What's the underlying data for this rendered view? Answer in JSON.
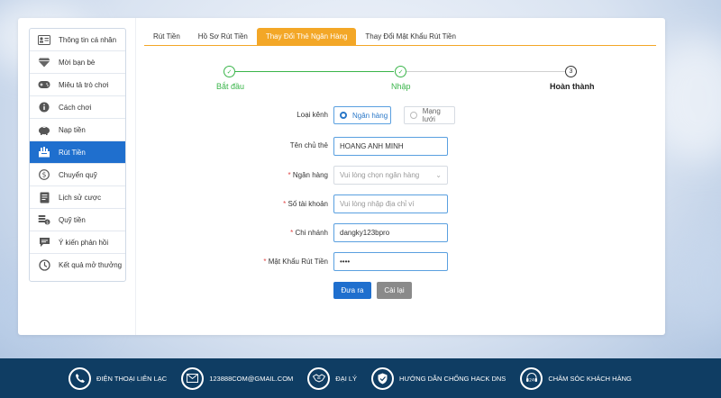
{
  "sidebar": {
    "items": [
      {
        "label": "Thông tin cá nhân",
        "icon": "id-card-icon"
      },
      {
        "label": "Mời bạn bè",
        "icon": "diamond-icon"
      },
      {
        "label": "Miêu tả trò chơi",
        "icon": "gamepad-icon"
      },
      {
        "label": "Cách chơi",
        "icon": "info-icon"
      },
      {
        "label": "Nạp tiền",
        "icon": "piggy-bank-icon"
      },
      {
        "label": "Rút Tiền",
        "icon": "withdraw-icon",
        "active": true
      },
      {
        "label": "Chuyển quỹ",
        "icon": "dollar-icon"
      },
      {
        "label": "Lịch sử cược",
        "icon": "document-icon"
      },
      {
        "label": "Quỹ tiền",
        "icon": "coins-icon"
      },
      {
        "label": "Ý kiến phản hồi",
        "icon": "chat-icon"
      },
      {
        "label": "Kết quả mở thưởng",
        "icon": "history-icon"
      }
    ]
  },
  "tabs": [
    {
      "label": "Rút Tiền"
    },
    {
      "label": "Hồ Sơ Rút Tiền"
    },
    {
      "label": "Thay Đổi Thẻ Ngân Hàng",
      "active": true
    },
    {
      "label": "Thay Đổi Mật Khẩu Rút Tiền"
    }
  ],
  "steps": {
    "step1": "Bắt đầu",
    "step2": "Nhập",
    "step3": "Hoàn thành",
    "step3_number": "3"
  },
  "form": {
    "channel_label": "Loại kênh",
    "channel_option_bank": "Ngân hàng",
    "channel_option_network": "Mạng lưới",
    "holder_label": "Tên chủ thẻ",
    "holder_value": "HOANG ANH MINH",
    "bank_label": "Ngân hàng",
    "bank_placeholder": "Vui lòng chọn ngân hàng",
    "account_label": "Số tài khoản",
    "account_placeholder": "Vui lòng nhập địa chỉ ví",
    "branch_label": "Chi nhánh",
    "branch_value": "dangky123bpro",
    "password_label": "Mật Khẩu Rút Tiền",
    "password_value": "••••",
    "required_mark": "*",
    "submit_label": "Đưa ra",
    "reset_label": "Cài lại"
  },
  "footer": {
    "items": [
      {
        "label": "ĐIỆN THOẠI LIÊN LẠC",
        "icon": "phone-icon"
      },
      {
        "label": "123888COM@GMAIL.COM",
        "icon": "mail-icon"
      },
      {
        "label": "ĐẠI LÝ",
        "icon": "handshake-icon"
      },
      {
        "label": "HƯỚNG DẪN CHỐNG HACK DNS",
        "icon": "shield-icon"
      },
      {
        "label": "CHĂM SÓC KHÁCH HÀNG",
        "icon": "support-24-icon"
      }
    ]
  },
  "colors": {
    "accent_blue": "#1f6fce",
    "tab_orange": "#f3a727",
    "step_green": "#3ab54a",
    "footer_navy": "#0f3d63"
  }
}
